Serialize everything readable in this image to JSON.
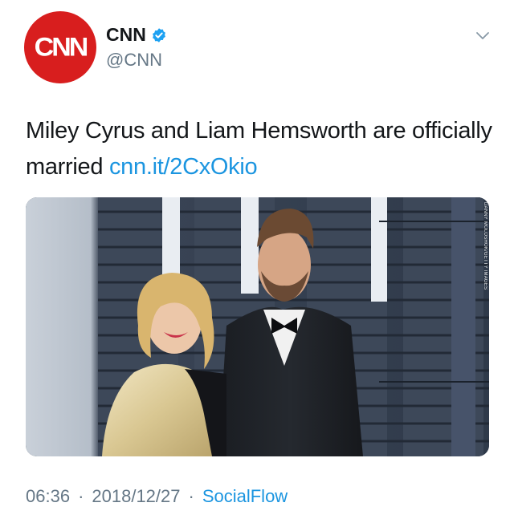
{
  "author": {
    "avatar_text": "CNN",
    "display_name": "CNN",
    "handle": "@CNN",
    "verified_icon": "verified-badge-icon",
    "menu_icon": "chevron-down-icon"
  },
  "tweet": {
    "text": "Miley Cyrus and Liam Hemsworth are officially married ",
    "link": "cnn.it/2CxOkio"
  },
  "media": {
    "photo_credit": "DANNY MOLOSHOK/GETTY IMAGES"
  },
  "meta": {
    "time": "06:36",
    "separator": "·",
    "date": "2018/12/27",
    "source": "SocialFlow"
  },
  "colors": {
    "brand_red": "#d81e1e",
    "link_blue": "#1b95e0",
    "muted_gray": "#657786",
    "text_dark": "#14171a"
  }
}
